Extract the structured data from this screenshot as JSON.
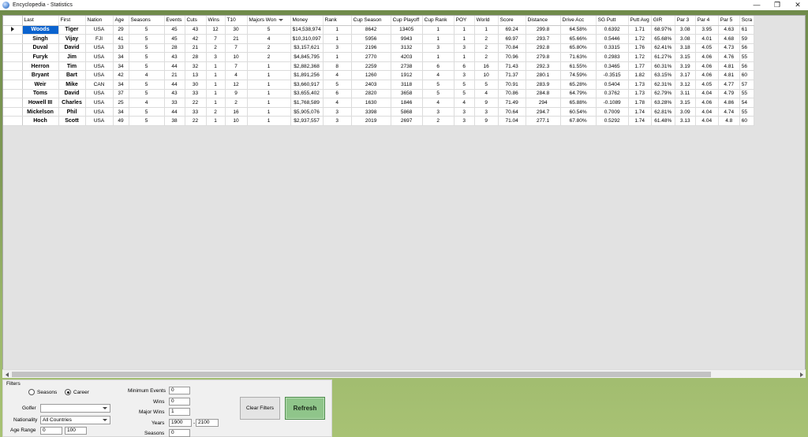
{
  "window": {
    "title": "Encyclopedia - Statistics",
    "minimize": "—",
    "maximize": "❐",
    "close": "✕"
  },
  "grid": {
    "columns": [
      "Last",
      "First",
      "Nation",
      "Age",
      "Seasons",
      "Events",
      "Cuts",
      "Wins",
      "T10",
      "Majors Won",
      "Money",
      "Rank",
      "Cup Season",
      "Cup Playoff",
      "Cup Rank",
      "POY",
      "World",
      "Score",
      "Distance",
      "Drive Acc",
      "SG Putt",
      "Putt Avg",
      "GIR",
      "Par 3",
      "Par 4",
      "Par 5",
      "Scra"
    ],
    "sorted_column": "Majors Won",
    "selected_row": 0,
    "rows": [
      [
        "Woods",
        "Tiger",
        "USA",
        "29",
        "5",
        "45",
        "43",
        "12",
        "30",
        "5",
        "$14,538,974",
        "1",
        "8642",
        "13405",
        "1",
        "1",
        "1",
        "69.24",
        "299.8",
        "64.58%",
        "0.6392",
        "1.71",
        "68.97%",
        "3.08",
        "3.95",
        "4.63",
        "61"
      ],
      [
        "Singh",
        "Vijay",
        "FJI",
        "41",
        "5",
        "45",
        "42",
        "7",
        "21",
        "4",
        "$10,310,097",
        "1",
        "5956",
        "9943",
        "1",
        "1",
        "2",
        "69.97",
        "293.7",
        "65.66%",
        "0.5446",
        "1.72",
        "65.68%",
        "3.08",
        "4.01",
        "4.68",
        "59"
      ],
      [
        "Duval",
        "David",
        "USA",
        "33",
        "5",
        "28",
        "21",
        "2",
        "7",
        "2",
        "$3,157,621",
        "3",
        "2196",
        "3132",
        "3",
        "3",
        "2",
        "70.84",
        "292.8",
        "65.80%",
        "0.3315",
        "1.76",
        "62.41%",
        "3.18",
        "4.05",
        "4.73",
        "56"
      ],
      [
        "Furyk",
        "Jim",
        "USA",
        "34",
        "5",
        "43",
        "28",
        "3",
        "10",
        "2",
        "$4,845,795",
        "1",
        "2770",
        "4203",
        "1",
        "1",
        "2",
        "70.96",
        "279.8",
        "71.63%",
        "0.2983",
        "1.72",
        "61.27%",
        "3.15",
        "4.06",
        "4.76",
        "55"
      ],
      [
        "Herron",
        "Tim",
        "USA",
        "34",
        "5",
        "44",
        "32",
        "1",
        "7",
        "1",
        "$2,882,368",
        "8",
        "2259",
        "2738",
        "6",
        "6",
        "16",
        "71.43",
        "292.3",
        "61.55%",
        "0.3465",
        "1.77",
        "60.31%",
        "3.19",
        "4.06",
        "4.81",
        "56"
      ],
      [
        "Bryant",
        "Bart",
        "USA",
        "42",
        "4",
        "21",
        "13",
        "1",
        "4",
        "1",
        "$1,891,256",
        "4",
        "1260",
        "1912",
        "4",
        "3",
        "10",
        "71.37",
        "280.1",
        "74.59%",
        "-0.3515",
        "1.82",
        "63.15%",
        "3.17",
        "4.06",
        "4.81",
        "60"
      ],
      [
        "Weir",
        "Mike",
        "CAN",
        "34",
        "5",
        "44",
        "30",
        "1",
        "12",
        "1",
        "$3,660,917",
        "5",
        "2403",
        "3118",
        "5",
        "5",
        "5",
        "70.91",
        "283.9",
        "65.28%",
        "0.5404",
        "1.73",
        "62.31%",
        "3.12",
        "4.05",
        "4.77",
        "57"
      ],
      [
        "Toms",
        "David",
        "USA",
        "37",
        "5",
        "43",
        "33",
        "1",
        "9",
        "1",
        "$3,655,402",
        "6",
        "2820",
        "3658",
        "5",
        "5",
        "4",
        "70.86",
        "284.8",
        "64.79%",
        "0.3762",
        "1.73",
        "62.79%",
        "3.11",
        "4.04",
        "4.79",
        "55"
      ],
      [
        "Howell III",
        "Charles",
        "USA",
        "25",
        "4",
        "33",
        "22",
        "1",
        "2",
        "1",
        "$1,768,589",
        "4",
        "1630",
        "1846",
        "4",
        "4",
        "9",
        "71.49",
        "294",
        "65.88%",
        "-0.1089",
        "1.78",
        "63.28%",
        "3.15",
        "4.06",
        "4.86",
        "54"
      ],
      [
        "Mickelson",
        "Phil",
        "USA",
        "34",
        "5",
        "44",
        "33",
        "2",
        "16",
        "1",
        "$5,905,076",
        "3",
        "3398",
        "5868",
        "3",
        "3",
        "3",
        "70.64",
        "294.7",
        "60.54%",
        "0.7009",
        "1.74",
        "62.81%",
        "3.09",
        "4.04",
        "4.74",
        "55"
      ],
      [
        "Hoch",
        "Scott",
        "USA",
        "49",
        "5",
        "38",
        "22",
        "1",
        "10",
        "1",
        "$2,937,557",
        "3",
        "2019",
        "2697",
        "2",
        "3",
        "9",
        "71.04",
        "277.1",
        "67.80%",
        "0.5292",
        "1.74",
        "61.48%",
        "3.13",
        "4.04",
        "4.8",
        "60"
      ]
    ]
  },
  "filters": {
    "title": "Filters",
    "radio_seasons": "Seasons",
    "radio_career": "Career",
    "selected_mode": "Career",
    "golfer_label": "Golfer",
    "golfer_value": "",
    "nationality_label": "Nationality",
    "nationality_value": "All Countries",
    "age_range_label": "Age Range",
    "age_min": "0",
    "age_max": "100",
    "min_events_label": "Minimum Events",
    "min_events": "0",
    "wins_label": "Wins",
    "wins": "0",
    "major_wins_label": "Major Wins",
    "major_wins": "1",
    "years_label": "Years",
    "year_from": "1900",
    "year_dash": "-",
    "year_to": "2100",
    "seasons_label": "Seasons",
    "seasons": "0",
    "clear_label": "Clear Filters",
    "refresh_label": "Refresh"
  }
}
